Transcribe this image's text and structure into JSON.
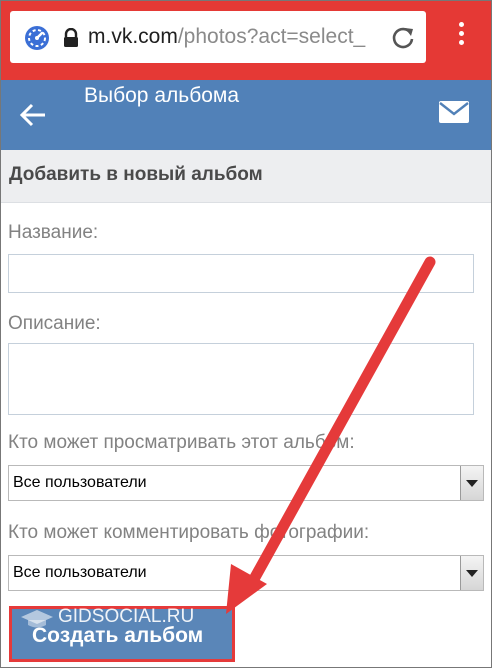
{
  "browser": {
    "url_host": "m.vk.com",
    "url_path": "/photos?act=select_",
    "accent": "#e53935"
  },
  "header": {
    "title": "Выбор альбома",
    "color": "#5181b8"
  },
  "section": {
    "title": "Добавить в новый альбом"
  },
  "form": {
    "name_label": "Название:",
    "name_value": "",
    "description_label": "Описание:",
    "description_value": "",
    "view_label": "Кто может просматривать этот альбом:",
    "view_selected": "Все пользователи",
    "comment_label": "Кто может комментировать фотографии:",
    "comment_selected": "Все пользователи",
    "submit_label": "Создать альбом"
  },
  "watermark": "GIDSOCIAL.RU",
  "annotation": {
    "arrow_color": "#e53a3a"
  }
}
